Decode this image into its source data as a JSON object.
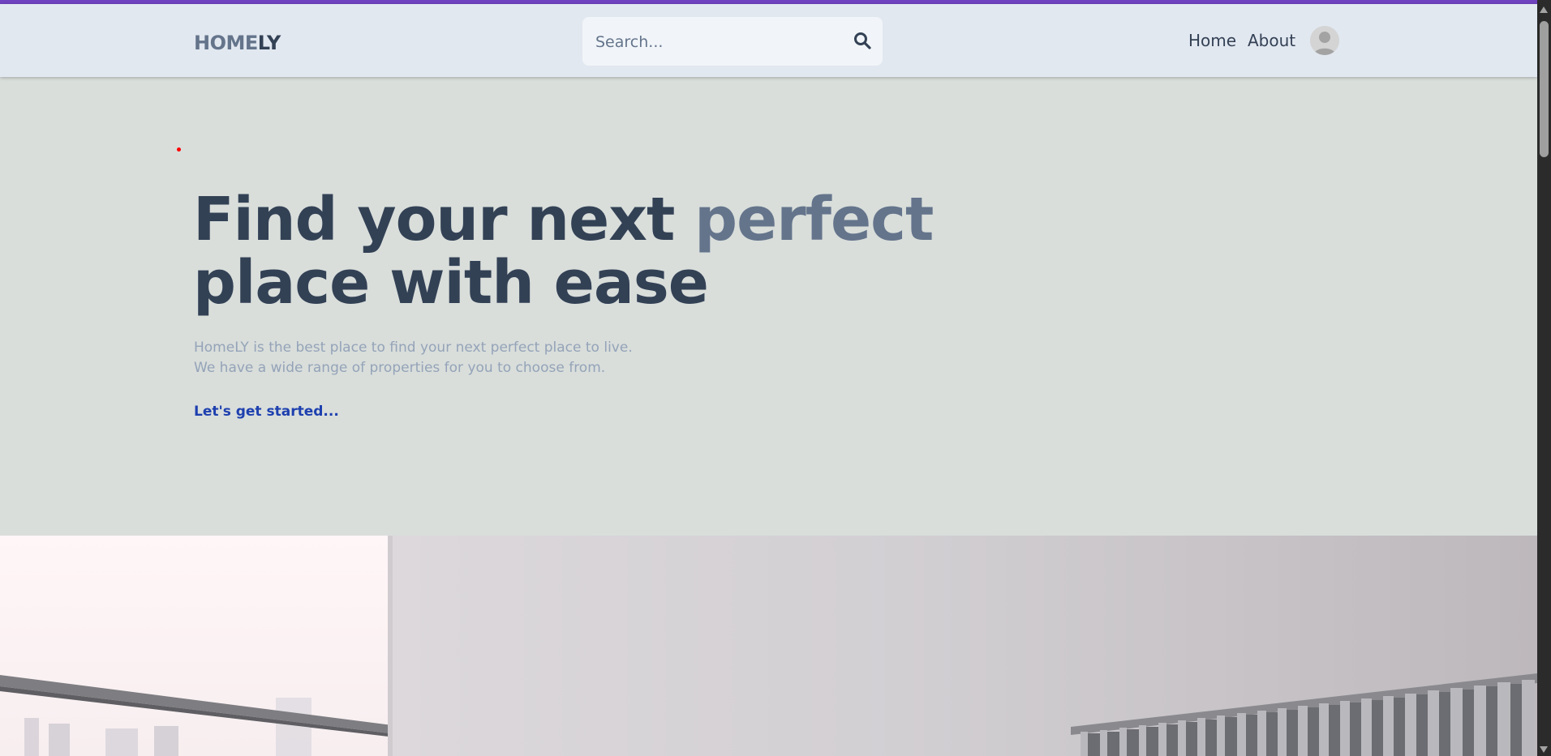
{
  "brand": {
    "logo_part1": "HOME",
    "logo_part2": "LY",
    "accent_color": "#6f42c1"
  },
  "header": {
    "search": {
      "placeholder": "Search...",
      "icon": "search-icon"
    },
    "nav": [
      {
        "label": "Home"
      },
      {
        "label": "About"
      }
    ],
    "avatar_icon": "user-avatar-icon"
  },
  "hero": {
    "headline_part1": "Find your next ",
    "headline_accent": "perfect",
    "headline_part2": "place with ease",
    "description_line1": "HomeLY is the best place to find your next perfect place to live.",
    "description_line2": "We have a wide range of properties for you to choose from.",
    "cta": "Let's get started..."
  },
  "colors": {
    "primary_text": "#334155",
    "secondary_text": "#64748b",
    "muted_text": "#94a3b8",
    "link": "#1e40af",
    "header_bg": "#e2e8f0",
    "hero_bg": "#d9dedb"
  }
}
